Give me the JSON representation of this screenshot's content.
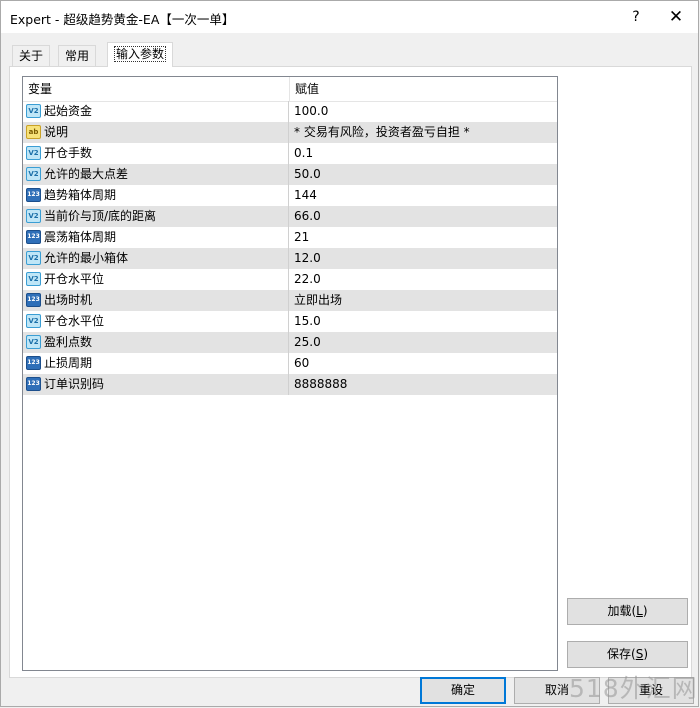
{
  "window": {
    "title": "Expert - 超级趋势黄金-EA【一次一单】",
    "help_label": "?",
    "close_label": "✕"
  },
  "tabs": [
    {
      "label": "关于",
      "active": false
    },
    {
      "label": "常用",
      "active": false
    },
    {
      "label": "输入参数",
      "active": true
    }
  ],
  "table": {
    "columns": [
      "变量",
      "赋值"
    ],
    "rows": [
      {
        "icon": "v2-icon",
        "name": "起始资金",
        "value": "100.0"
      },
      {
        "icon": "ab-icon",
        "name": "说明",
        "value": "* 交易有风险，投资者盈亏自担 *"
      },
      {
        "icon": "v2-icon",
        "name": "开仓手数",
        "value": "0.1"
      },
      {
        "icon": "v2-icon",
        "name": "允许的最大点差",
        "value": "50.0"
      },
      {
        "icon": "123-icon",
        "name": "趋势箱体周期",
        "value": "144"
      },
      {
        "icon": "v2-icon",
        "name": "当前价与顶/底的距离",
        "value": "66.0"
      },
      {
        "icon": "123-icon",
        "name": "震荡箱体周期",
        "value": "21"
      },
      {
        "icon": "v2-icon",
        "name": "允许的最小箱体",
        "value": "12.0"
      },
      {
        "icon": "v2-icon",
        "name": "开仓水平位",
        "value": "22.0"
      },
      {
        "icon": "123-icon",
        "name": "出场时机",
        "value": "立即出场"
      },
      {
        "icon": "v2-icon",
        "name": "平仓水平位",
        "value": "15.0"
      },
      {
        "icon": "v2-icon",
        "name": "盈利点数",
        "value": "25.0"
      },
      {
        "icon": "123-icon",
        "name": "止损周期",
        "value": "60"
      },
      {
        "icon": "123-icon",
        "name": "订单识别码",
        "value": "8888888"
      }
    ]
  },
  "icon_glyphs": {
    "v2-icon": "V2",
    "ab-icon": "ab",
    "123-icon": "123"
  },
  "buttons": {
    "load": {
      "text": "加载(",
      "key": "L",
      "end": ")"
    },
    "save": {
      "text": "保存(",
      "key": "S",
      "end": ")"
    },
    "ok": "确定",
    "cancel": "取消",
    "reset": "重设"
  },
  "watermark": "518外汇网"
}
